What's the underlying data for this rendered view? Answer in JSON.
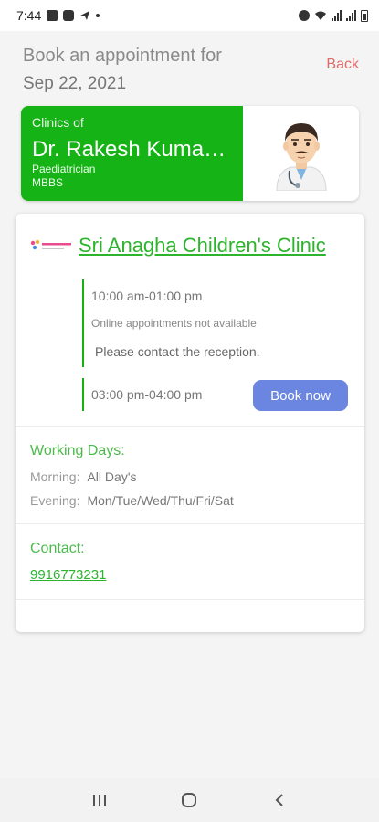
{
  "status_bar": {
    "time": "7:44"
  },
  "header": {
    "label": "Book an appointment for",
    "date": "Sep 22, 2021",
    "back_label": "Back"
  },
  "doctor": {
    "clinics_of_label": "Clinics of",
    "name": "Dr. Rakesh Kumar B...",
    "specialty": "Paediatrician",
    "degree": "MBBS"
  },
  "clinic": {
    "name": "Sri Anagha Children's Clinic",
    "slots": [
      {
        "time": "10:00 am-01:00 pm",
        "note": "Online appointments not available",
        "contact_note": "Please contact the reception."
      },
      {
        "time": "03:00 pm-04:00 pm",
        "book_label": "Book now"
      }
    ],
    "working_days": {
      "title": "Working Days:",
      "morning_label": "Morning:",
      "morning_value": "All Day's",
      "evening_label": "Evening:",
      "evening_value": "Mon/Tue/Wed/Thu/Fri/Sat"
    },
    "contact": {
      "title": "Contact:",
      "phone": "9916773231"
    }
  },
  "colors": {
    "brand_green": "#15b315",
    "link_green": "#2db42d",
    "button_blue": "#6b86e0",
    "back_red": "#e06a6a"
  }
}
